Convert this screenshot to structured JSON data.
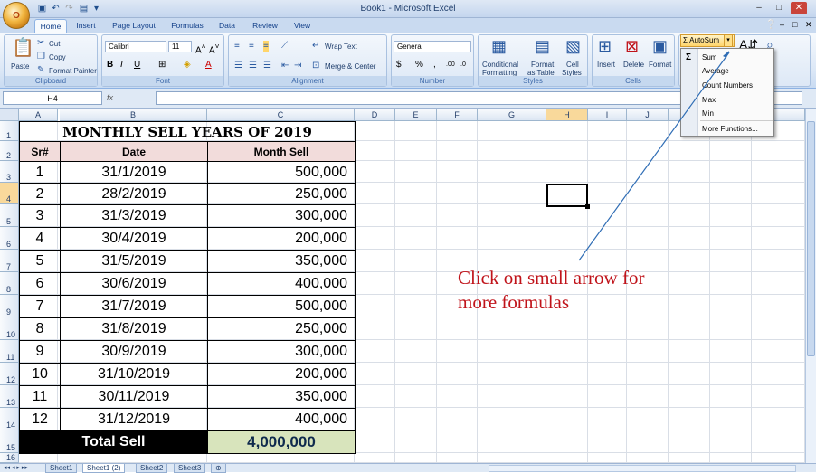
{
  "window": {
    "title": "Book1 - Microsoft Excel"
  },
  "office_button": {
    "label": "O"
  },
  "tabs": [
    {
      "label": "Home",
      "active": true
    },
    {
      "label": "Insert"
    },
    {
      "label": "Page Layout"
    },
    {
      "label": "Formulas"
    },
    {
      "label": "Data"
    },
    {
      "label": "Review"
    },
    {
      "label": "View"
    }
  ],
  "ribbon": {
    "clipboard": {
      "paste": "Paste",
      "cut": "Cut",
      "copy": "Copy",
      "format_painter": "Format Painter",
      "label": "Clipboard"
    },
    "font": {
      "name": "Calibri",
      "size": "11",
      "label": "Font",
      "bold": "B",
      "italic": "I",
      "underline": "U"
    },
    "alignment": {
      "wrap": "Wrap Text",
      "merge": "Merge & Center",
      "label": "Alignment"
    },
    "number": {
      "format": "General",
      "label": "Number",
      "currency": "$",
      "percent": "%"
    },
    "styles": {
      "conditional": "Conditional",
      "conditional2": "Formatting",
      "format_as": "Format",
      "format_as2": "as Table",
      "cell": "Cell",
      "cell2": "Styles",
      "label": "Styles"
    },
    "cells": {
      "insert": "Insert",
      "delete": "Delete",
      "format": "Format",
      "label": "Cells"
    },
    "editing": {
      "autosum": "AutoSum"
    }
  },
  "autosum_menu": {
    "items": [
      "Sum",
      "Average",
      "Count Numbers",
      "Max",
      "Min",
      "More Functions..."
    ]
  },
  "formula_bar": {
    "name_box": "H4",
    "fx": "fx",
    "value": ""
  },
  "columns": [
    "A",
    "B",
    "C",
    "D",
    "E",
    "F",
    "G",
    "H",
    "I",
    "J"
  ],
  "rows": [
    "1",
    "2",
    "3",
    "4",
    "5",
    "6",
    "7",
    "8",
    "9",
    "10",
    "11",
    "12",
    "13",
    "14",
    "15",
    "16"
  ],
  "sheet": {
    "title": "MONTHLY SELL YEARS OF 2019",
    "headers": [
      "Sr#",
      "Date",
      "Month Sell"
    ],
    "data": [
      [
        "1",
        "31/1/2019",
        "500,000"
      ],
      [
        "2",
        "28/2/2019",
        "250,000"
      ],
      [
        "3",
        "31/3/2019",
        "300,000"
      ],
      [
        "4",
        "30/4/2019",
        "200,000"
      ],
      [
        "5",
        "31/5/2019",
        "350,000"
      ],
      [
        "6",
        "30/6/2019",
        "400,000"
      ],
      [
        "7",
        "31/7/2019",
        "500,000"
      ],
      [
        "8",
        "31/8/2019",
        "250,000"
      ],
      [
        "9",
        "30/9/2019",
        "300,000"
      ],
      [
        "10",
        "31/10/2019",
        "200,000"
      ],
      [
        "11",
        "30/11/2019",
        "350,000"
      ],
      [
        "12",
        "31/12/2019",
        "400,000"
      ]
    ],
    "total_label": "Total Sell",
    "total_value": "4,000,000"
  },
  "annotation": {
    "line1": "Click on small arrow for",
    "line2": "more formulas"
  },
  "sheet_tabs": [
    {
      "label": "Sheet1"
    },
    {
      "label": "Sheet1 (2)",
      "active": true
    },
    {
      "label": "Sheet2"
    },
    {
      "label": "Sheet3"
    }
  ],
  "colors": {
    "header_fill": "#f2dcdb",
    "total_label_fill": "#000000",
    "total_value_fill": "#d8e4bc",
    "annotation": "#c0131a",
    "arrow": "#2f6db5"
  }
}
